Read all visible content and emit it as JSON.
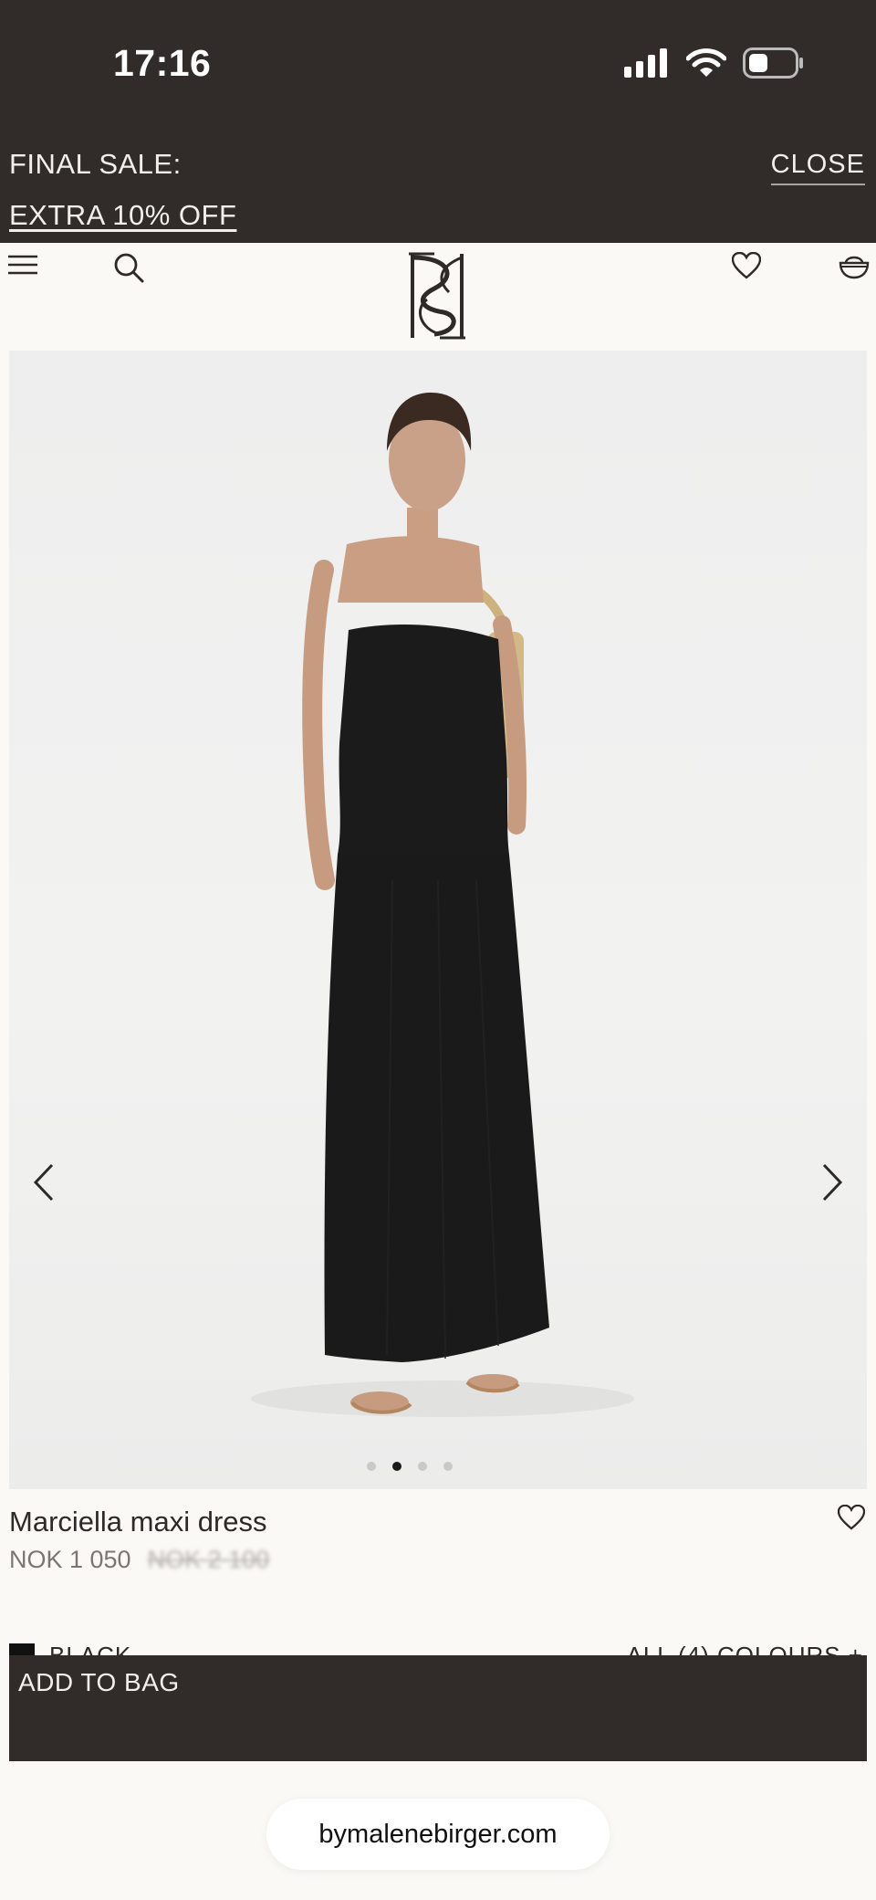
{
  "status_bar": {
    "time": "17:16"
  },
  "promo": {
    "title": "FINAL SALE:",
    "link": "EXTRA 10% OFF",
    "close": "CLOSE"
  },
  "nav": {
    "icons": [
      "menu-icon",
      "search-icon",
      "brand-logo",
      "heart-icon",
      "bag-icon"
    ]
  },
  "gallery": {
    "image_count": 4,
    "active_index": 1,
    "icons": [
      "chevron-left-icon",
      "chevron-right-icon"
    ]
  },
  "product": {
    "name": "Marciella maxi dress",
    "price_sale": "NOK 1 050",
    "price_original": "NOK 2 100",
    "colour": "BLACK",
    "all_colours": "ALL (4) COLOURS +",
    "colour_swatch": "#111111"
  },
  "cta": {
    "add_to_bag": "ADD TO BAG"
  },
  "browser": {
    "url": "bymalenebirger.com"
  },
  "colors": {
    "dark": "#312c2a",
    "background": "#faf9f6"
  }
}
